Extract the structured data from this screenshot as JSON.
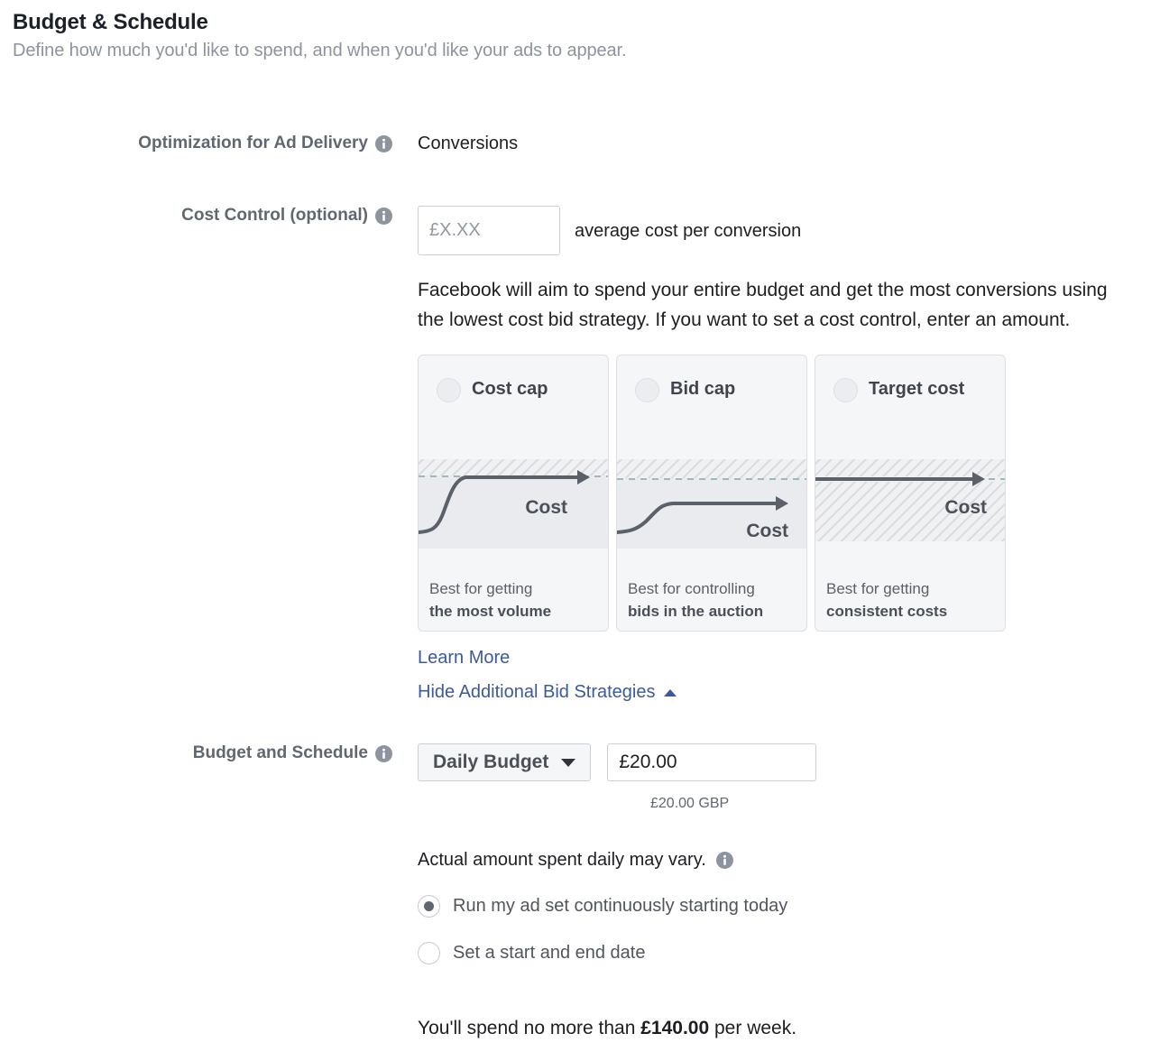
{
  "header": {
    "title": "Budget & Schedule",
    "subtitle": "Define how much you'd like to spend, and when you'd like your ads to appear."
  },
  "optimization": {
    "label": "Optimization for Ad Delivery",
    "info_icon": "info-icon",
    "value": "Conversions"
  },
  "cost_control": {
    "label": "Cost Control (optional)",
    "info_icon": "info-icon",
    "input_placeholder": "£X.XX",
    "input_value": "",
    "suffix": "average cost per conversion",
    "description": "Facebook will aim to spend your entire budget and get the most conversions using the lowest cost bid strategy. If you want to set a cost control, enter an amount.",
    "cards": [
      {
        "title": "Cost cap",
        "radio_state": "unselected",
        "graphic": "cost-cap-curve",
        "foot_line1": "Best for getting",
        "foot_line2": "the most volume"
      },
      {
        "title": "Bid cap",
        "radio_state": "unselected",
        "graphic": "bid-cap-curve",
        "foot_line1": "Best for controlling",
        "foot_line2": "bids in the auction"
      },
      {
        "title": "Target cost",
        "radio_state": "unselected",
        "graphic": "target-cost-line",
        "foot_line1": "Best for getting",
        "foot_line2": "consistent costs"
      }
    ],
    "graphic_label": "Cost",
    "learn_more": "Learn More",
    "hide_strategies": "Hide Additional Bid Strategies"
  },
  "budget_schedule": {
    "label": "Budget and Schedule",
    "info_icon": "info-icon",
    "budget_type": "Daily Budget",
    "budget_amount": "£20.00",
    "currency_note": "£20.00 GBP",
    "vary_note": "Actual amount spent daily may vary.",
    "vary_info_icon": "info-icon",
    "schedule_options": [
      {
        "label": "Run my ad set continuously starting today",
        "selected": true
      },
      {
        "label": "Set a start and end date",
        "selected": false
      }
    ],
    "spend_cap_prefix": "You'll spend no more than ",
    "spend_cap_amount": "£140.00",
    "spend_cap_suffix": " per week."
  },
  "colors": {
    "link": "#3b5a9b",
    "muted": "#8d949e",
    "text": "#1c1e21",
    "card_bg": "#f5f6f7"
  }
}
